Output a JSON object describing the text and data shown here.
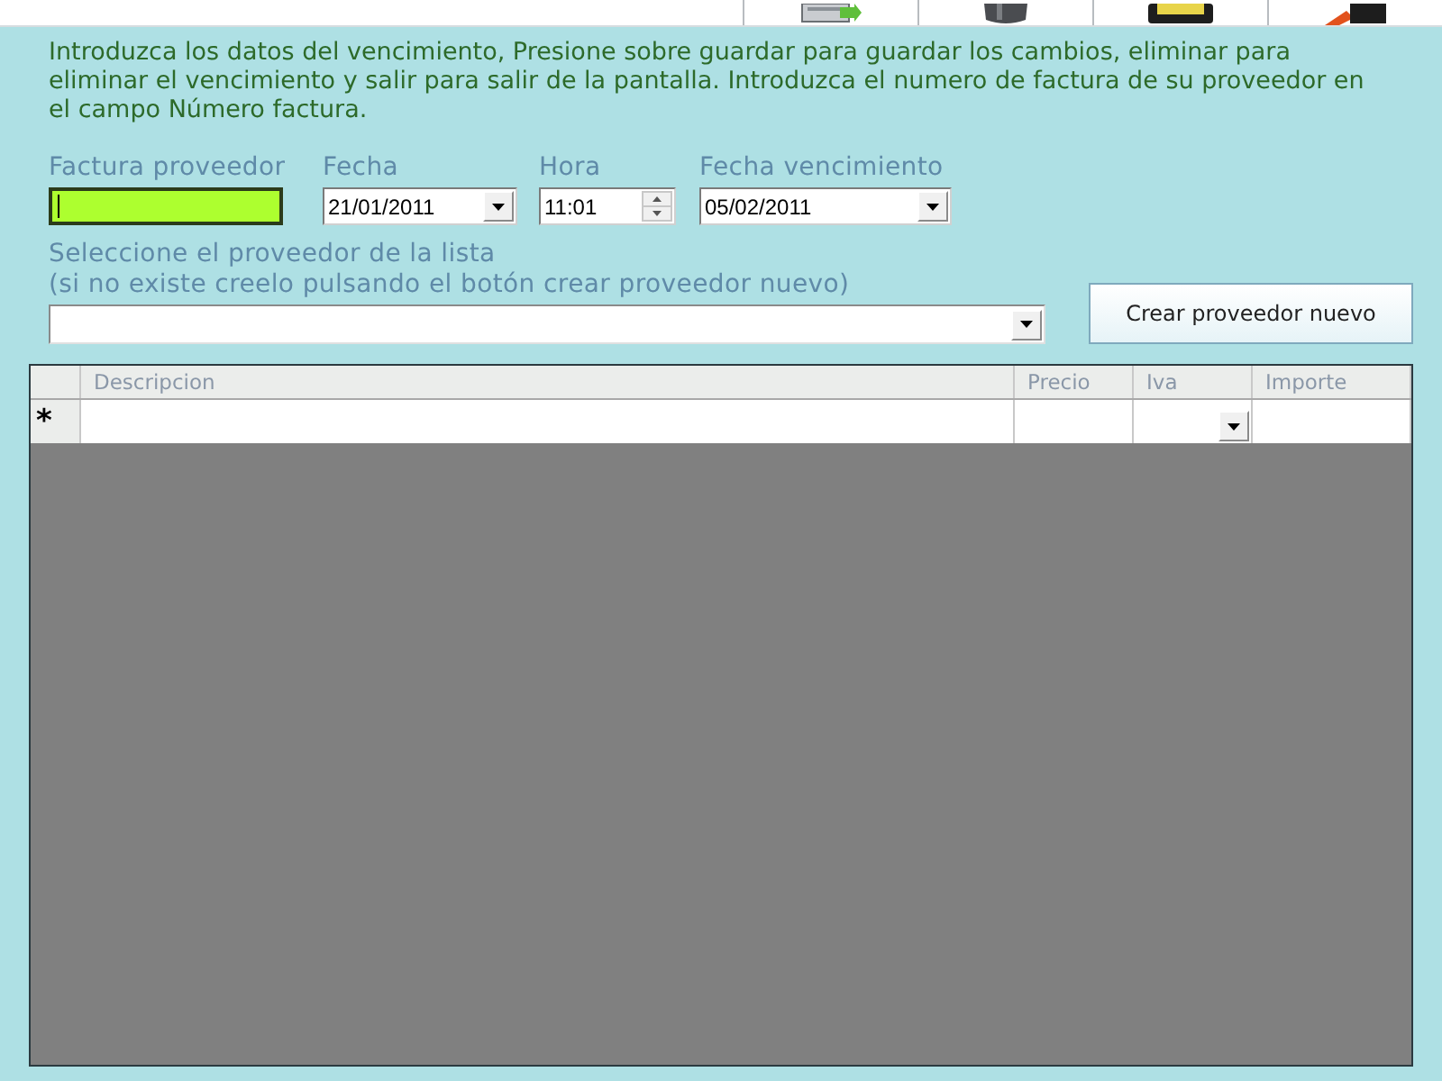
{
  "instructions": "Introduzca los datos del vencimiento, Presione sobre guardar para guardar los cambios, eliminar para eliminar el vencimiento y salir para salir de la pantalla. Introduzca el numero de factura de su proveedor en el campo Número factura.",
  "fields": [
    {
      "kind": "text",
      "label": "Factura proveedor",
      "focused": true
    },
    {
      "kind": "date",
      "label": "Fecha",
      "value": "21/01/2011"
    },
    {
      "kind": "time",
      "label": "Hora",
      "value": "11:01"
    },
    {
      "kind": "date",
      "label": "Fecha vencimiento",
      "value": "05/02/2011"
    }
  ],
  "supplier": {
    "label_lines": [
      "Seleccione el proveedor de la lista",
      "(si no existe creelo pulsando el botón crear proveedor nuevo)"
    ],
    "button": "Crear proveedor nuevo"
  },
  "grid": {
    "columns": [
      {
        "label": "Descripcion",
        "kind": "text"
      },
      {
        "label": "Precio",
        "kind": "text"
      },
      {
        "label": "Iva",
        "kind": "combo"
      },
      {
        "label": "Importe",
        "kind": "text"
      }
    ],
    "new_row_marker": "*"
  }
}
